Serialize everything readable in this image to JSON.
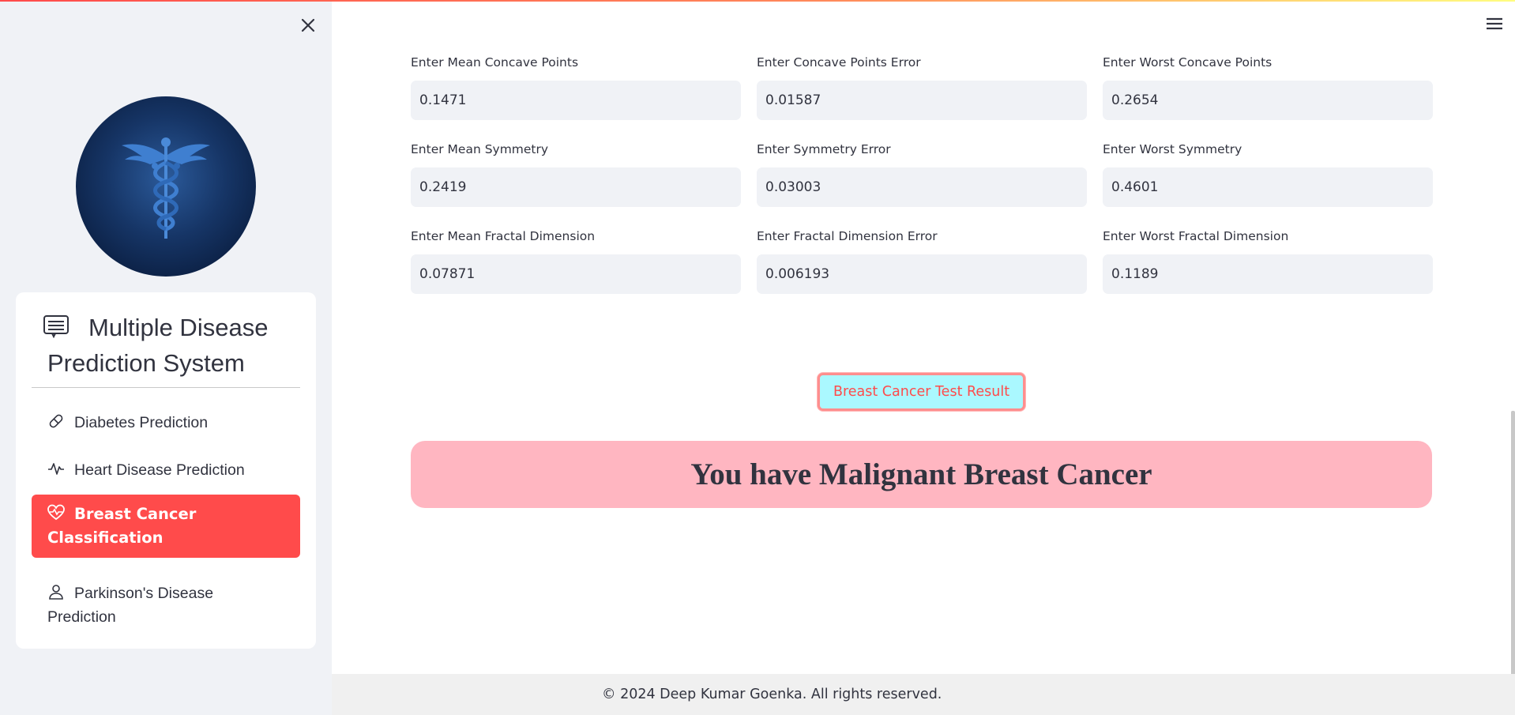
{
  "app": {
    "accent_color": "#ff4b4b",
    "sidebar_bg": "#f0f2f6"
  },
  "sidebar": {
    "close_icon": "close-icon",
    "logo_icon": "caduceus-icon",
    "menu_title": "Multiple Disease Prediction System",
    "menu_title_icon": "list-window-icon",
    "items": [
      {
        "label": "Diabetes Prediction",
        "icon": "capsule-icon",
        "active": false
      },
      {
        "label": "Heart Disease Prediction",
        "icon": "activity-icon",
        "active": false
      },
      {
        "label": "Breast Cancer Classification",
        "icon": "heart-pulse-icon",
        "active": true
      },
      {
        "label": "Parkinson's Disease Prediction",
        "icon": "person-icon",
        "active": false
      }
    ]
  },
  "main": {
    "menu_icon": "hamburger-icon",
    "fields": [
      {
        "label": "Enter Mean Concave Points",
        "value": "0.1471"
      },
      {
        "label": "Enter Concave Points Error",
        "value": "0.01587"
      },
      {
        "label": "Enter Worst Concave Points",
        "value": "0.2654"
      },
      {
        "label": "Enter Mean Symmetry",
        "value": "0.2419"
      },
      {
        "label": "Enter Symmetry Error",
        "value": "0.03003"
      },
      {
        "label": "Enter Worst Symmetry",
        "value": "0.4601"
      },
      {
        "label": "Enter Mean Fractal Dimension",
        "value": "0.07871"
      },
      {
        "label": "Enter Fractal Dimension Error",
        "value": "0.006193"
      },
      {
        "label": "Enter Worst Fractal Dimension",
        "value": "0.1189"
      }
    ],
    "result_button_label": "Breast Cancer Test Result",
    "result_message": "You have Malignant Breast Cancer"
  },
  "footer": {
    "text": "© 2024 Deep Kumar Goenka. All rights reserved."
  }
}
